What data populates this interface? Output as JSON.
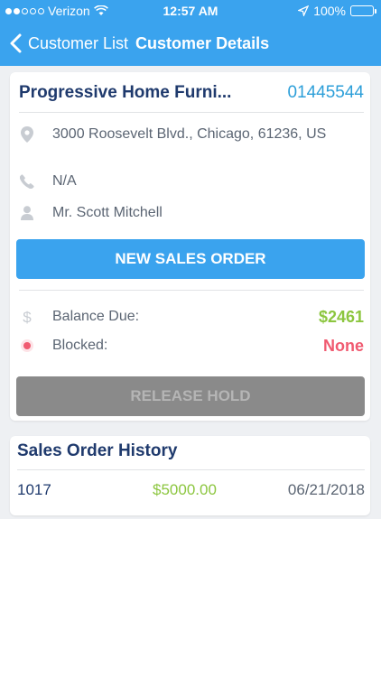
{
  "status_bar": {
    "carrier": "Verizon",
    "time": "12:57 AM",
    "battery": "100%"
  },
  "nav": {
    "back_label": "Customer List",
    "title": "Customer Details"
  },
  "customer": {
    "name": "Progressive Home Furni...",
    "id": "01445544",
    "address": "3000 Roosevelt Blvd., Chicago, 61236, US",
    "phone": "N/A",
    "contact": "Mr. Scott Mitchell"
  },
  "actions": {
    "new_sales_order": "NEW SALES ORDER",
    "release_hold": "RELEASE HOLD"
  },
  "account": {
    "balance_label": "Balance Due:",
    "balance_value": "$2461",
    "blocked_label": "Blocked:",
    "blocked_value": "None"
  },
  "history": {
    "title": "Sales Order History",
    "rows": [
      {
        "order": "1017",
        "amount": "$5000.00",
        "date": "06/21/2018"
      }
    ]
  },
  "colors": {
    "brand_blue": "#3aa3ee",
    "navy_text": "#1f3a6d",
    "id_blue": "#2d9fd9",
    "green": "#8cc63f",
    "red": "#f05a70",
    "disabled": "#8a8a8a"
  },
  "icons": {
    "location": "location-pin-icon",
    "phone": "phone-icon",
    "person": "person-icon",
    "dollar": "dollar-icon",
    "blocked": "status-dot-icon"
  }
}
